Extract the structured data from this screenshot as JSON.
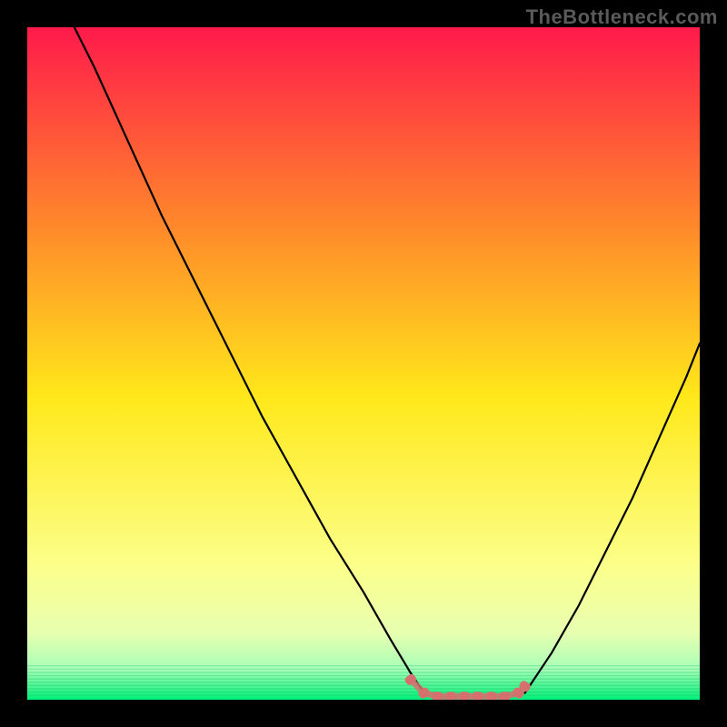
{
  "watermark": "TheBottleneck.com",
  "colors": {
    "background": "#000000",
    "gradient_top": "#ff1a4b",
    "gradient_mid_upper": "#ff8a2a",
    "gradient_mid": "#ffe81a",
    "gradient_mid_lower": "#fcff8a",
    "gradient_lower": "#e8ffb0",
    "gradient_bottom": "#00f07a",
    "curve": "#000000",
    "marker": "#d6706f"
  },
  "chart_data": {
    "type": "line",
    "title": "",
    "xlabel": "",
    "ylabel": "",
    "xlim": [
      0,
      100
    ],
    "ylim": [
      0,
      100
    ],
    "series": [
      {
        "name": "bottleneck-curve-left",
        "x": [
          7,
          10,
          15,
          20,
          25,
          30,
          35,
          40,
          45,
          50,
          54,
          57,
          59
        ],
        "y": [
          100,
          94,
          83,
          72,
          62,
          52,
          42,
          33,
          24,
          16,
          9,
          4,
          1
        ]
      },
      {
        "name": "bottleneck-curve-right",
        "x": [
          74,
          78,
          82,
          86,
          90,
          94,
          98,
          100
        ],
        "y": [
          1,
          7,
          14,
          22,
          30,
          39,
          48,
          53
        ]
      },
      {
        "name": "bottleneck-valley-markers",
        "x": [
          57,
          59,
          61,
          63,
          65,
          67,
          69,
          71,
          73,
          74
        ],
        "y": [
          3,
          1,
          0.5,
          0.5,
          0.5,
          0.5,
          0.5,
          0.5,
          1,
          2
        ]
      }
    ],
    "annotations": []
  }
}
